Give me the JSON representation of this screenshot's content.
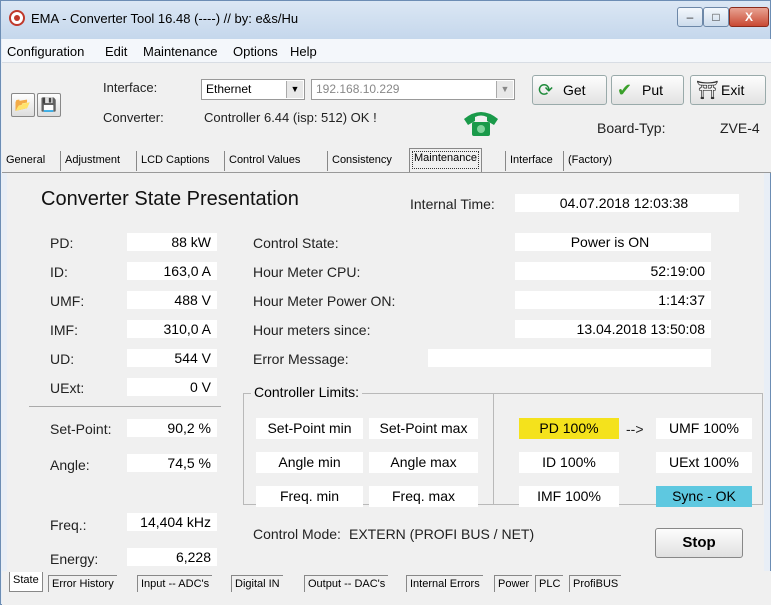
{
  "window": {
    "title": "EMA - Converter Tool 16.48 (----)  // by: e&s/Hu",
    "min": "–",
    "max": "□",
    "close": "X"
  },
  "menu": [
    "Configuration",
    "Edit",
    "Maintenance",
    "Options",
    "Help"
  ],
  "toolbar": {
    "interface_label": "Interface:",
    "interface_value": "Ethernet",
    "ip_value": "192.168.10.229",
    "converter_label": "Converter:",
    "converter_value": "Controller 6.44 (isp: 512) OK !",
    "get_label": "Get",
    "put_label": "Put",
    "exit_label": "Exit",
    "board_label": "Board-Typ:",
    "board_value": "ZVE-4"
  },
  "tabs": [
    "General",
    "Adjustment",
    "LCD Captions",
    "Control Values",
    "Consistency",
    "Maintenance",
    "Interface",
    "(Factory)"
  ],
  "active_tab": "Maintenance",
  "panel": {
    "title": "Converter State Presentation",
    "internal_time_label": "Internal Time:",
    "internal_time_value": "04.07.2018  12:03:38",
    "measurements": [
      {
        "label": "PD:",
        "value": "88 kW"
      },
      {
        "label": "ID:",
        "value": "163,0 A"
      },
      {
        "label": "UMF:",
        "value": "488 V"
      },
      {
        "label": "IMF:",
        "value": "310,0 A"
      },
      {
        "label": "UD:",
        "value": "544 V"
      },
      {
        "label": "UExt:",
        "value": "0 V"
      }
    ],
    "setpoint_label": "Set-Point:",
    "setpoint_value": "90,2 %",
    "angle_label": "Angle:",
    "angle_value": "74,5 %",
    "freq_label": "Freq.:",
    "freq_value": "14,404 kHz",
    "energy_label": "Energy:",
    "energy_value": "6,228",
    "status": [
      {
        "label": "Control State:",
        "value": "Power is ON"
      },
      {
        "label": "Hour Meter  CPU:",
        "value": "52:19:00"
      },
      {
        "label": "Hour Meter  Power ON:",
        "value": "1:14:37"
      },
      {
        "label": "Hour meters since:",
        "value": "13.04.2018  13:50:08"
      },
      {
        "label": "Error Message:",
        "value": ""
      }
    ],
    "limits": {
      "title": "Controller Limits:",
      "left": [
        "Set-Point min",
        "Set-Point max",
        "Angle min",
        "Angle max",
        "Freq. min",
        "Freq. max"
      ],
      "pd": "PD  100%",
      "arrow": "-->",
      "umf": "UMF 100%",
      "id": "ID  100%",
      "uext": "UExt 100%",
      "imf": "IMF 100%",
      "sync": "Sync - OK"
    },
    "control_mode_label": "Control Mode:",
    "control_mode_value": "EXTERN (PROFI BUS / NET)",
    "stop_label": "Stop"
  },
  "bottom_tabs": [
    "State",
    "Error History",
    "Input -- ADC's",
    "Digital  IN",
    "Output -- DAC's",
    "Internal Errors",
    "Power",
    "PLC",
    "ProfiBUS"
  ],
  "colors": {
    "pd_highlight": "#f4e21c",
    "sync_highlight": "#5ec8e0",
    "title_bar": "#c5d7ec"
  }
}
